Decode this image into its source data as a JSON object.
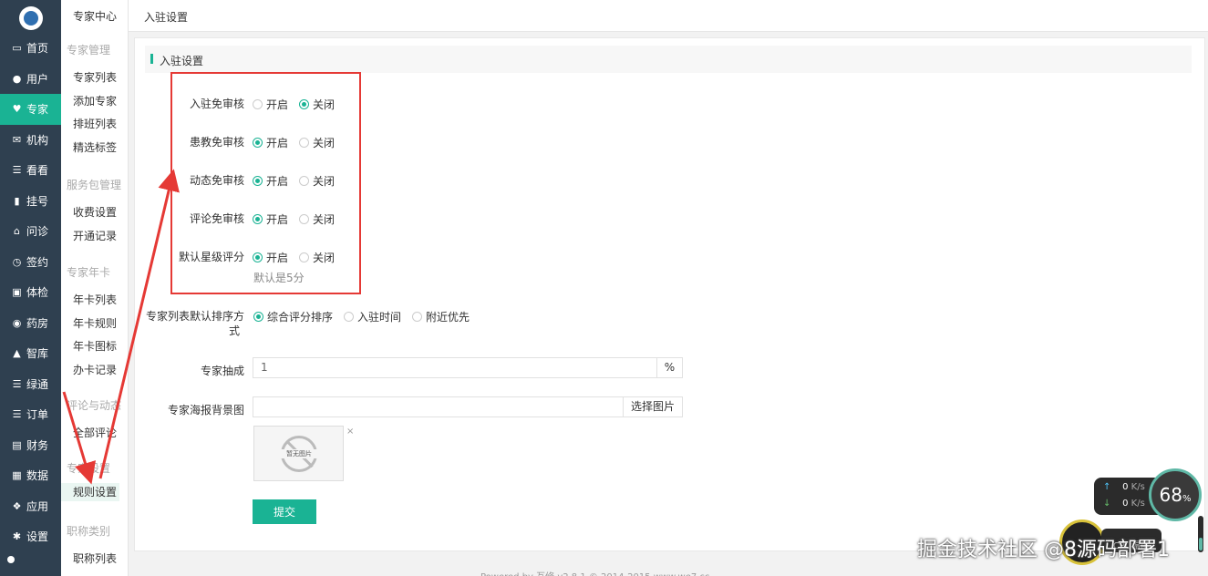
{
  "nav1": {
    "items": [
      {
        "label": "首页",
        "icon": "monitor-icon",
        "glyph": "▭"
      },
      {
        "label": "用户",
        "icon": "user-icon",
        "glyph": "●"
      },
      {
        "label": "专家",
        "icon": "heart-icon",
        "glyph": "♥",
        "active": true
      },
      {
        "label": "机构",
        "icon": "envelope-icon",
        "glyph": "✉"
      },
      {
        "label": "看看",
        "icon": "list-icon",
        "glyph": "☰"
      },
      {
        "label": "挂号",
        "icon": "signal-icon",
        "glyph": "▮"
      },
      {
        "label": "问诊",
        "icon": "home-icon",
        "glyph": "⌂"
      },
      {
        "label": "签约",
        "icon": "clock-icon",
        "glyph": "◷"
      },
      {
        "label": "体检",
        "icon": "inbox-icon",
        "glyph": "▣"
      },
      {
        "label": "药房",
        "icon": "dashboard-icon",
        "glyph": "◉"
      },
      {
        "label": "智库",
        "icon": "lock-icon",
        "glyph": "▲"
      },
      {
        "label": "绿通",
        "icon": "list-icon",
        "glyph": "☰"
      },
      {
        "label": "订单",
        "icon": "list-icon",
        "glyph": "☰"
      },
      {
        "label": "财务",
        "icon": "money-icon",
        "glyph": "▤"
      },
      {
        "label": "数据",
        "icon": "grid-icon",
        "glyph": "▦"
      },
      {
        "label": "应用",
        "icon": "cubes-icon",
        "glyph": "❖"
      },
      {
        "label": "设置",
        "icon": "gear-icon",
        "glyph": "✱"
      }
    ]
  },
  "nav2": {
    "header": "专家中心",
    "groups": [
      {
        "title": "专家管理",
        "items": [
          "专家列表",
          "添加专家",
          "排班列表",
          "精选标签"
        ]
      },
      {
        "title": "服务包管理",
        "items": [
          "收费设置",
          "开通记录"
        ]
      },
      {
        "title": "专家年卡",
        "items": [
          "年卡列表",
          "年卡规则",
          "年卡图标",
          "办卡记录"
        ]
      },
      {
        "title": "评论与动态",
        "items": [
          "全部评论"
        ]
      },
      {
        "title": "专家设置",
        "items": [
          "规则设置"
        ]
      },
      {
        "title": "职称类别",
        "items": [
          "职称列表"
        ]
      }
    ]
  },
  "topbar": {
    "title": "入驻设置"
  },
  "section": {
    "title": "入驻设置"
  },
  "form": {
    "toggles": [
      {
        "label": "入驻免审核",
        "on_label": "开启",
        "off_label": "关闭",
        "value": "off"
      },
      {
        "label": "患教免审核",
        "on_label": "开启",
        "off_label": "关闭",
        "value": "on"
      },
      {
        "label": "动态免审核",
        "on_label": "开启",
        "off_label": "关闭",
        "value": "on"
      },
      {
        "label": "评论免审核",
        "on_label": "开启",
        "off_label": "关闭",
        "value": "on"
      },
      {
        "label": "默认星级评分",
        "on_label": "开启",
        "off_label": "关闭",
        "value": "on"
      }
    ],
    "star_hint": "默认是5分",
    "sort": {
      "label_line1": "专家列表默认排序方",
      "label_line2": "式",
      "options": [
        "综合评分排序",
        "入驻时间",
        "附近优先"
      ],
      "selected": 0
    },
    "commission": {
      "label": "专家抽成",
      "value": "1",
      "unit": "%"
    },
    "poster": {
      "label": "专家海报背景图",
      "value": "",
      "button": "选择图片",
      "placeholder_image": "暂无图片",
      "remove": "×"
    },
    "submit": "提交"
  },
  "footer": "Powered by 互修 v2.8.1 © 2014-2015 www.we7.cc",
  "overlay": {
    "net_up": "0",
    "net_down": "0",
    "net_unit": "K/s",
    "gauge_value": "68",
    "gauge_unit": "%",
    "cpu_label": "CPU温度",
    "watermark": "掘金技术社区 @8源码部署1"
  },
  "colors": {
    "accent": "#1ab394",
    "nav_bg": "#2f4050",
    "highlight": "#e53935"
  }
}
